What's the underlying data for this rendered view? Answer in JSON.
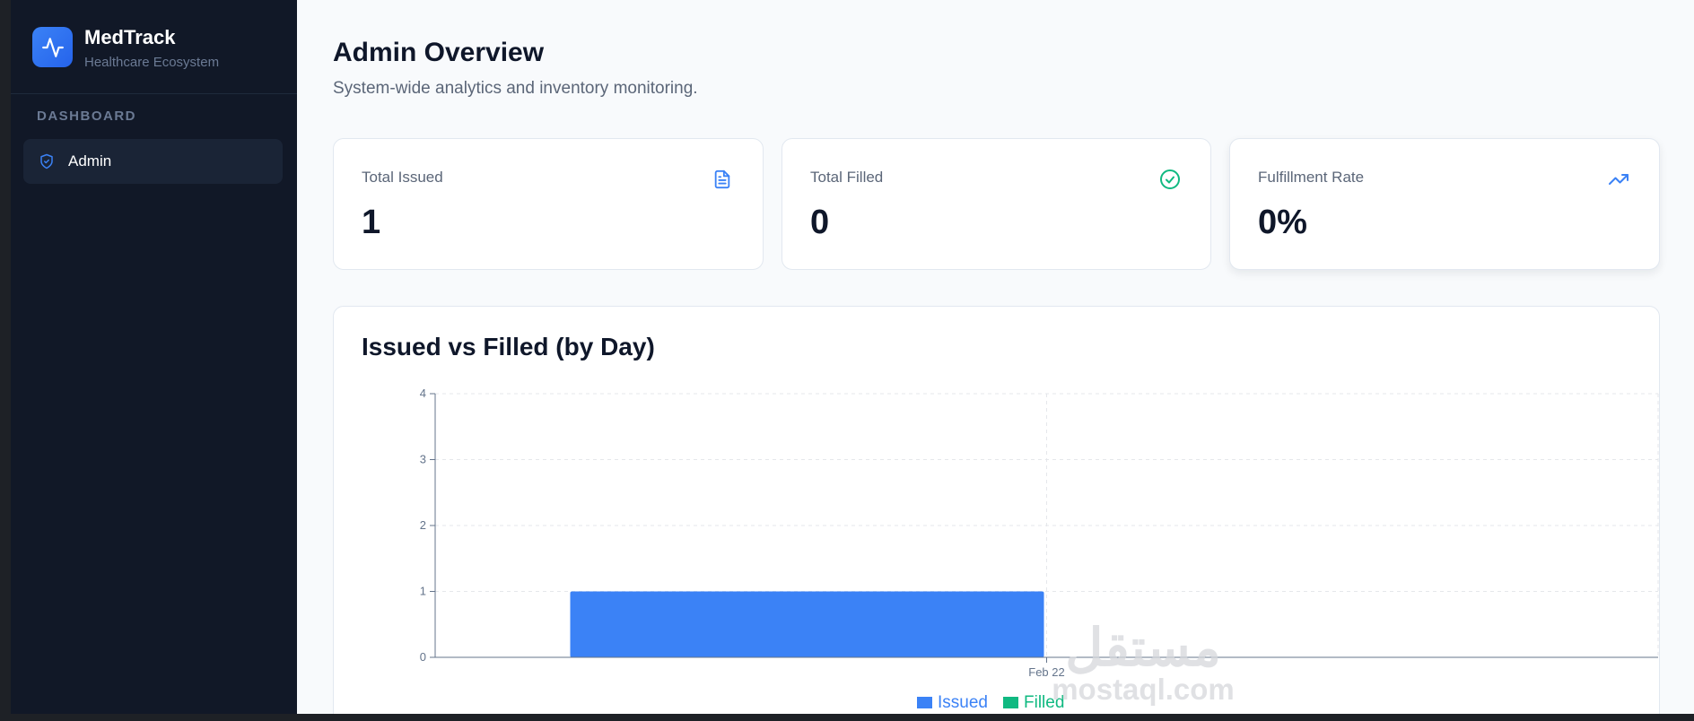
{
  "app": {
    "name": "MedTrack",
    "tagline": "Healthcare Ecosystem"
  },
  "sidebar": {
    "section_title": "DASHBOARD",
    "items": [
      {
        "label": "Admin",
        "icon": "shield-check-icon",
        "active": true
      }
    ]
  },
  "header": {
    "title": "Admin Overview",
    "subtitle": "System-wide analytics and inventory monitoring."
  },
  "stats": [
    {
      "label": "Total Issued",
      "value": "1",
      "icon": "document-icon",
      "icon_color": "#3b82f6"
    },
    {
      "label": "Total Filled",
      "value": "0",
      "icon": "check-circle-icon",
      "icon_color": "#10b981"
    },
    {
      "label": "Fulfillment Rate",
      "value": "0%",
      "icon": "trending-up-icon",
      "icon_color": "#3b82f6"
    }
  ],
  "chart": {
    "title": "Issued vs Filled (by Day)"
  },
  "chart_data": {
    "type": "bar",
    "categories": [
      "Feb 22"
    ],
    "series": [
      {
        "name": "Issued",
        "values": [
          1
        ],
        "color": "#3b82f6"
      },
      {
        "name": "Filled",
        "values": [
          0
        ],
        "color": "#10b981"
      }
    ],
    "ylim": [
      0,
      4
    ],
    "yticks": [
      0,
      1,
      2,
      3,
      4
    ],
    "grid": true,
    "legend": "bottom"
  },
  "watermark": {
    "arabic": "مستقل",
    "latin": "mostaql.com"
  }
}
